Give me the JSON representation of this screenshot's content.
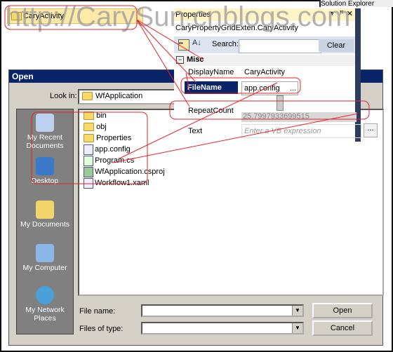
{
  "watermark": "http://CarySun.cnblogs.com",
  "activity": {
    "label": "CaryActivity"
  },
  "solution_explorer": "Solution Explorer",
  "properties": {
    "title": "Properties",
    "subtitle": "CaryPropertyGridExten.CaryActivity",
    "search_label": "Search:",
    "clear_label": "Clear",
    "category": "Misc",
    "rows": [
      {
        "name": "DisplayName",
        "value": "CaryActivity"
      },
      {
        "name": "FileName",
        "value": "app.config"
      },
      {
        "name": "RepeatCount",
        "value": "25.7997933699515"
      },
      {
        "name": "Text",
        "placeholder": "Enter a VB expression"
      }
    ],
    "ellipsis": "..."
  },
  "dialog": {
    "title": "Open",
    "look_in_label": "Look in:",
    "look_in_value": "WfApplication",
    "places": [
      "My Recent Documents",
      "Desktop",
      "My Documents",
      "My Computer",
      "My Network Places"
    ],
    "files": [
      {
        "name": "bin",
        "type": "folder"
      },
      {
        "name": "obj",
        "type": "folder"
      },
      {
        "name": "Properties",
        "type": "folder"
      },
      {
        "name": "app.config",
        "type": "config"
      },
      {
        "name": "Program.cs",
        "type": "cs"
      },
      {
        "name": "WfApplication.csproj",
        "type": "csproj"
      },
      {
        "name": "Workflow1.xaml",
        "type": "xaml"
      }
    ],
    "file_name_label": "File name:",
    "file_name_value": "",
    "files_of_type_label": "Files of type:",
    "files_of_type_value": "",
    "open_label": "Open",
    "cancel_label": "Cancel"
  },
  "colors": {
    "annotation": "#e8212a",
    "title_bar": "#0a246a",
    "selection": "#0a246a"
  }
}
